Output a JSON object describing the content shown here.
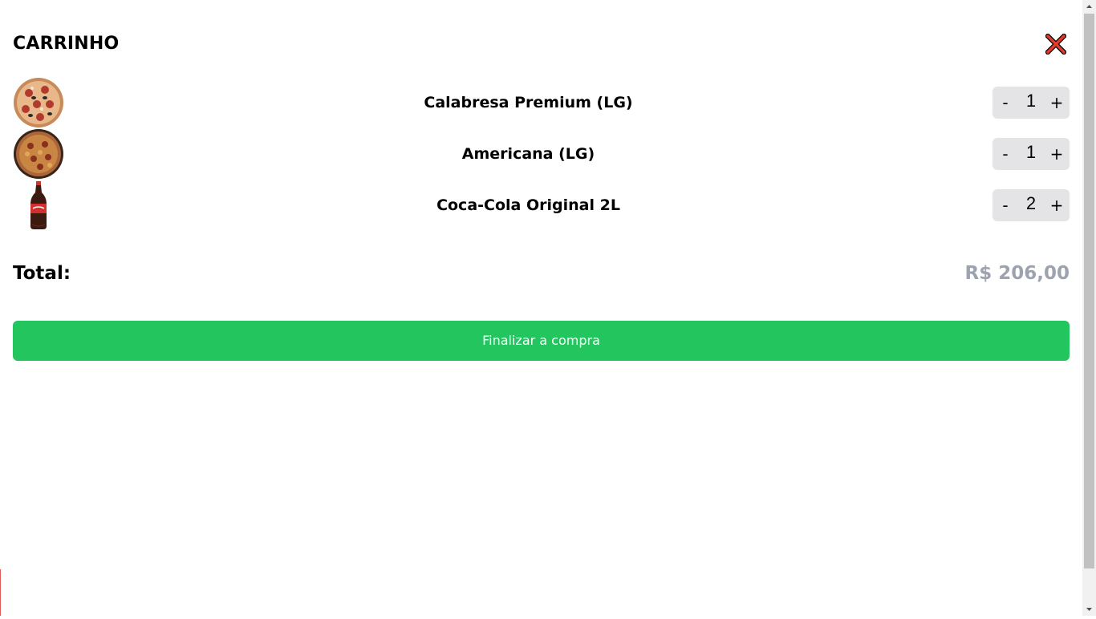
{
  "cart": {
    "title": "CARRINHO",
    "items": [
      {
        "name": "Calabresa Premium (LG)",
        "quantity": "1",
        "image_icon": "pizza-calabresa-image"
      },
      {
        "name": "Americana (LG)",
        "quantity": "1",
        "image_icon": "pizza-americana-image"
      },
      {
        "name": "Coca-Cola Original 2L",
        "quantity": "2",
        "image_icon": "coca-cola-bottle-image"
      }
    ],
    "minus_label": "-",
    "plus_label": "+",
    "total_label": "Total:",
    "total_value": "R$ 206,00",
    "checkout_label": "Finalizar a compra"
  },
  "colors": {
    "checkout_bg": "#22c55e",
    "close_icon": "#e33b2b",
    "total_value": "#9ca3af",
    "qty_bg": "#e4e4e7"
  }
}
